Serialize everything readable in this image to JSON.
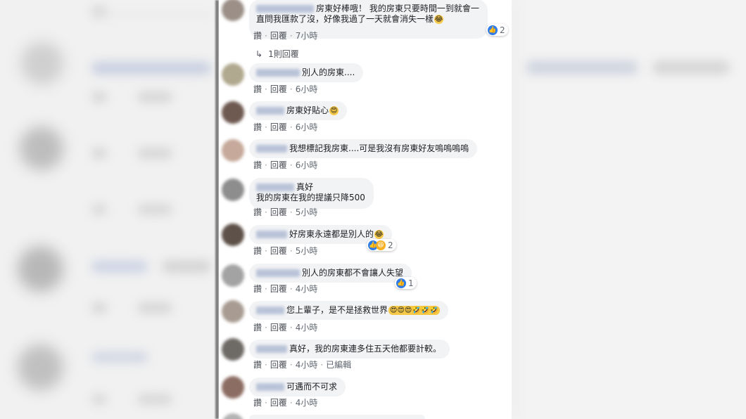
{
  "actions": {
    "like": "讚",
    "reply": "回覆",
    "edited": "已編輯"
  },
  "comments": [
    {
      "line1": "房東好棒哦！ 我的房東只要時間一到就會一",
      "line2": "直問我匯款了沒，好像我過了一天就會消失一樣",
      "emoji": "😂",
      "time": "7小時",
      "reactions": {
        "count": "2"
      },
      "replies_label": "1則回覆"
    },
    {
      "text": "別人的房東....",
      "time": "6小時"
    },
    {
      "text": "房東好貼心",
      "emoji": "😍",
      "time": "6小時"
    },
    {
      "text": "我想標記我房東....可是我沒有房東好友嗚嗚嗚嗚",
      "time": "6小時"
    },
    {
      "line1": "真好",
      "line2": "我的房東在我的提議只降500",
      "time": "5小時"
    },
    {
      "text": "好房東永遠都是別人的",
      "emoji": "😂",
      "time": "5小時",
      "reactions": {
        "count": "2"
      }
    },
    {
      "text": "別人的房東都不會讓人失望",
      "time": "4小時",
      "reactions": {
        "count": "1"
      }
    },
    {
      "text": "您上輩子，是不是拯救世界",
      "emoji": "😍😍😍🤣🤣🤣",
      "time": "4小時"
    },
    {
      "text": "真好，我的房東連多住五天他都要計較。",
      "time": "4小時",
      "edited": true
    },
    {
      "text": "可遇而不可求",
      "time": "4小時"
    }
  ],
  "colors": {
    "like_blue": "#2f7ce8",
    "haha_yellow": "#f7b125",
    "bubble_bg": "#f2f3f5",
    "action_gray": "#606770"
  },
  "icons": [
    "like-reaction-icon",
    "haha-reaction-icon",
    "reply-arrow-icon"
  ]
}
